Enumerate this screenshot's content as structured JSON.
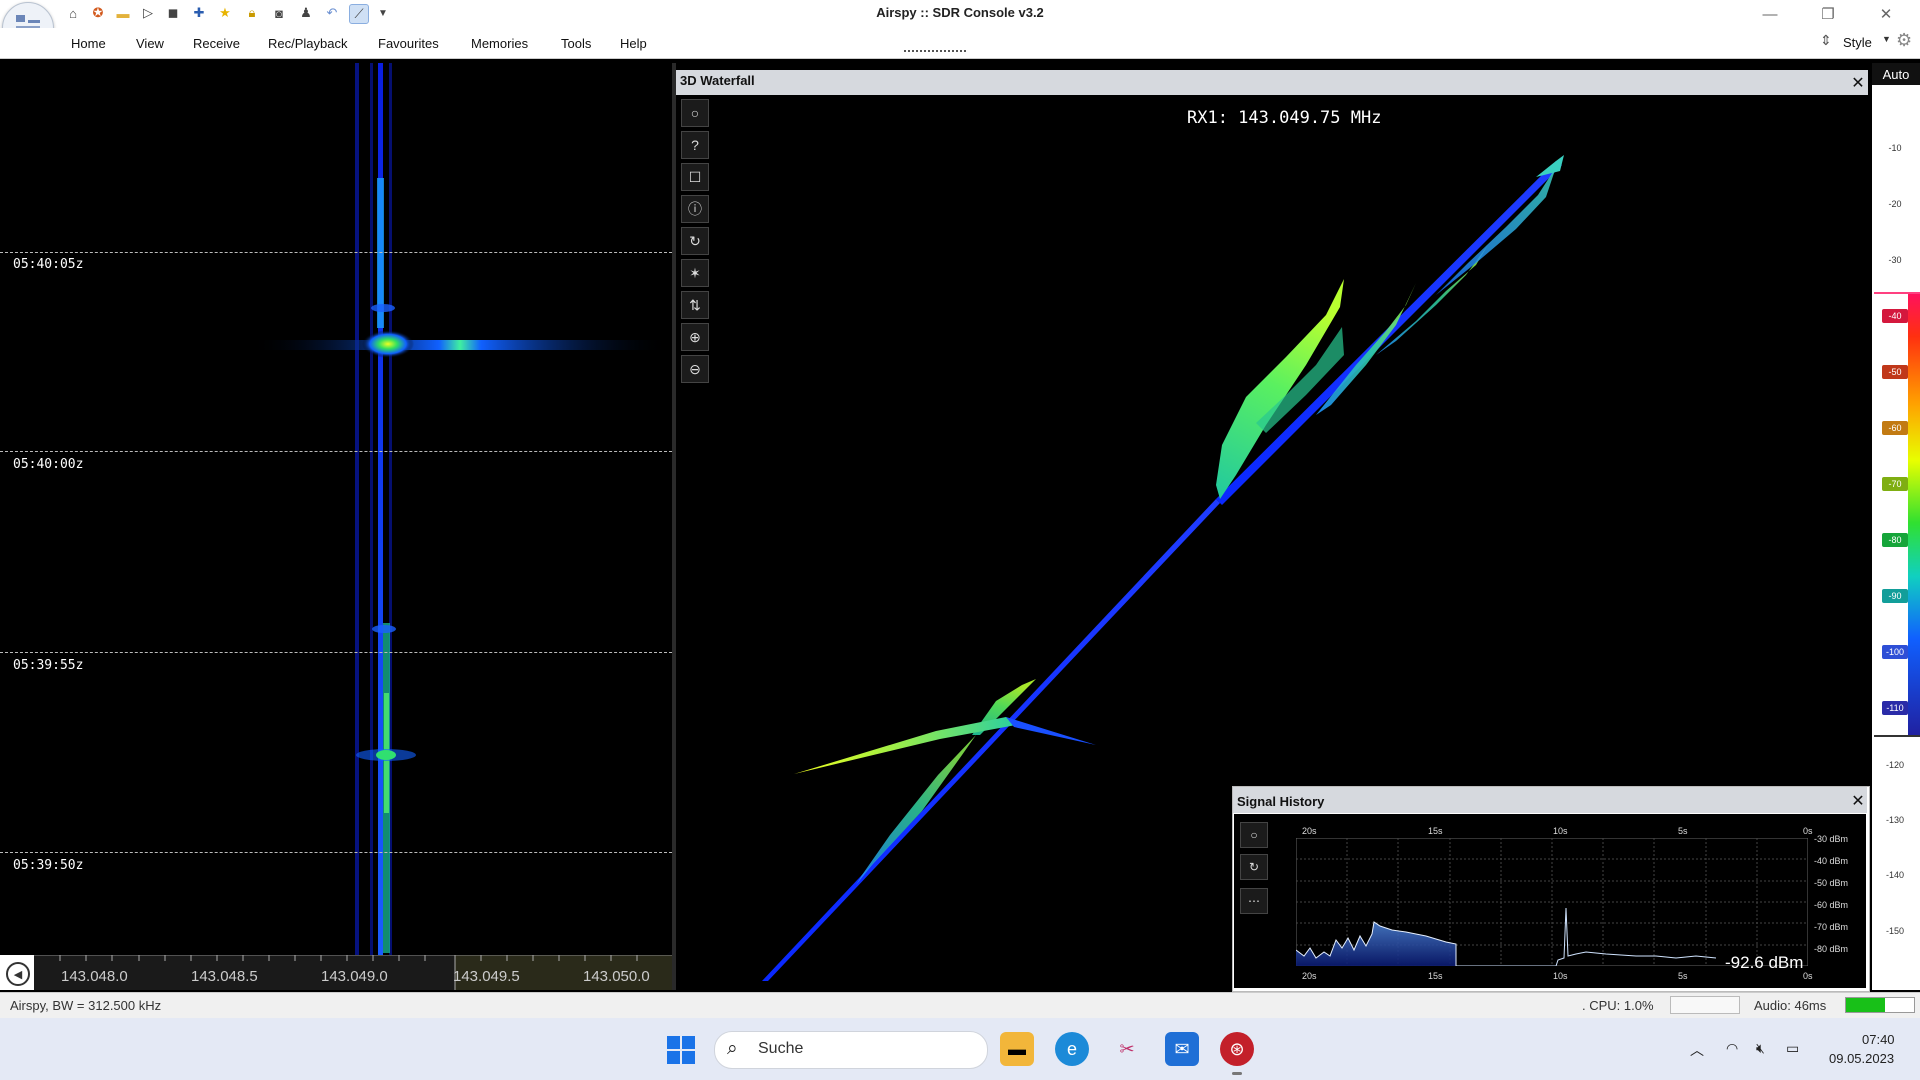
{
  "window": {
    "title": "Airspy :: SDR Console v3.2",
    "style_label": "Style",
    "menu": [
      "Home",
      "View",
      "Receive",
      "Rec/Playback",
      "Favourites",
      "Memories",
      "Tools",
      "Help"
    ]
  },
  "waterfall2d": {
    "time_labels": [
      "05:40:05z",
      "05:40:00z",
      "05:39:55z",
      "05:39:50z"
    ],
    "freq_ticks": [
      "143.048.0",
      "143.048.5",
      "143.049.0",
      "143.049.5",
      "143.050.0"
    ]
  },
  "waterfall3d": {
    "title": "3D Waterfall",
    "rx_label": "RX1: 143.049.75 MHz",
    "tools": [
      "circle-icon",
      "help-icon",
      "square-icon",
      "info-icon",
      "reset-icon",
      "star-icon",
      "swap-icon",
      "zoom-in-icon",
      "zoom-out-icon"
    ]
  },
  "scale": {
    "auto_label": "Auto",
    "levels": [
      "-10",
      "-20",
      "-30",
      "-40",
      "-50",
      "-60",
      "-70",
      "-80",
      "-90",
      "-100",
      "-110",
      "-120",
      "-130",
      "-140",
      "-150"
    ],
    "badge_colors": {
      "-40": "#d4183d",
      "-50": "#c0381a",
      "-60": "#c27a12",
      "-70": "#7fae12",
      "-80": "#16a53a",
      "-90": "#129e9a",
      "-100": "#2e4fd6",
      "-110": "#2a2ba8"
    }
  },
  "signal_history": {
    "title": "Signal History",
    "time_labels": [
      "20s",
      "15s",
      "10s",
      "5s",
      "0s"
    ],
    "db_labels": [
      "-30 dBm",
      "-40 dBm",
      "-50 dBm",
      "-60 dBm",
      "-70 dBm",
      "-80 dBm"
    ],
    "value": "-92.6 dBm"
  },
  "status": {
    "left": "Airspy, BW = 312.500 kHz",
    "cpu": ". CPU: 1.0%",
    "audio": "Audio: 46ms"
  },
  "taskbar": {
    "search_placeholder": "Suche",
    "time": "07:40",
    "date": "09.05.2023"
  }
}
